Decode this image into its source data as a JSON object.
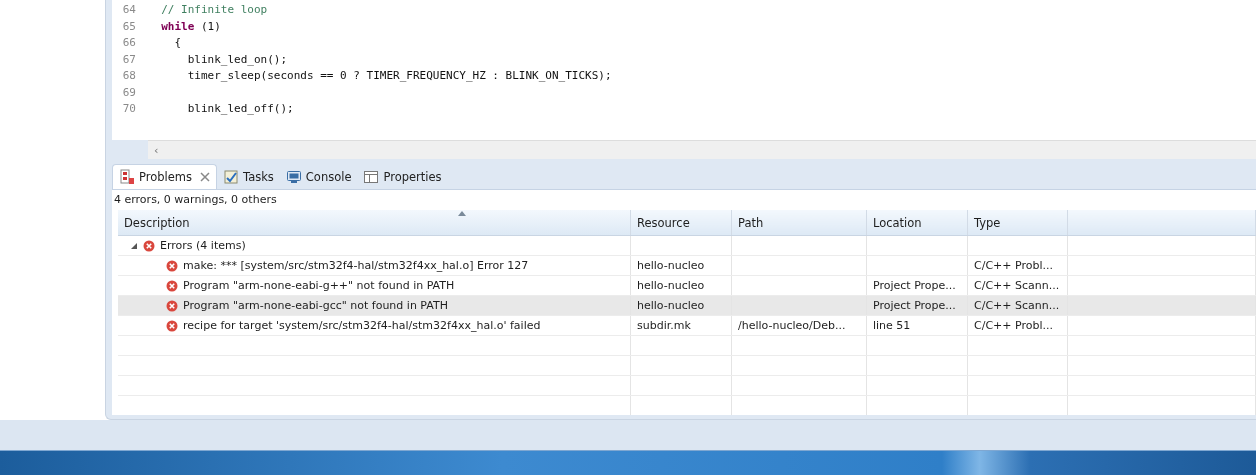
{
  "editor": {
    "lines": [
      {
        "number": "64",
        "tokens": [
          {
            "text": "  // Infinite loop",
            "kind": "comment"
          }
        ]
      },
      {
        "number": "65",
        "tokens": [
          {
            "text": "  while",
            "kind": "keyword"
          },
          {
            "text": " (1)",
            "kind": "plain"
          }
        ]
      },
      {
        "number": "66",
        "tokens": [
          {
            "text": "    {",
            "kind": "plain"
          }
        ]
      },
      {
        "number": "67",
        "tokens": [
          {
            "text": "      blink_led_on();",
            "kind": "plain"
          }
        ]
      },
      {
        "number": "68",
        "tokens": [
          {
            "text": "      timer_sleep(seconds == 0 ? TIMER_FREQUENCY_HZ : BLINK_ON_TICKS);",
            "kind": "plain"
          }
        ]
      },
      {
        "number": "69"
      },
      {
        "number": "70",
        "tokens": [
          {
            "text": "      blink_led_off();",
            "kind": "plain"
          }
        ]
      }
    ],
    "scroll_arrow": "‹"
  },
  "tabs": [
    {
      "label": "Problems",
      "selected": true,
      "closable": true
    },
    {
      "label": "Tasks",
      "selected": false,
      "closable": false
    },
    {
      "label": "Console",
      "selected": false,
      "closable": false
    },
    {
      "label": "Properties",
      "selected": false,
      "closable": false
    }
  ],
  "summary": "4 errors, 0 warnings, 0 others",
  "table": {
    "columns": [
      "Description",
      "Resource",
      "Path",
      "Location",
      "Type"
    ],
    "groups": [
      {
        "label": "Errors (4 items)",
        "expanded": true,
        "children": [
          {
            "description": "make: *** [system/src/stm32f4-hal/stm32f4xx_hal.o] Error 127",
            "resource": "hello-nucleo",
            "type": "C/C++ Probl...",
            "selected": false
          },
          {
            "description": "Program \"arm-none-eabi-g++\" not found in PATH",
            "resource": "hello-nucleo",
            "location": "Project Prope...",
            "type": "C/C++ Scann...",
            "selected": false
          },
          {
            "description": "Program \"arm-none-eabi-gcc\" not found in PATH",
            "resource": "hello-nucleo",
            "location": "Project Prope...",
            "type": "C/C++ Scann...",
            "selected": true
          },
          {
            "description": "recipe for target 'system/src/stm32f4-hal/stm32f4xx_hal.o' failed",
            "resource": "subdir.mk",
            "path": "/hello-nucleo/Deb...",
            "location": "line 51",
            "type": "C/C++ Probl...",
            "selected": false
          }
        ]
      }
    ]
  }
}
